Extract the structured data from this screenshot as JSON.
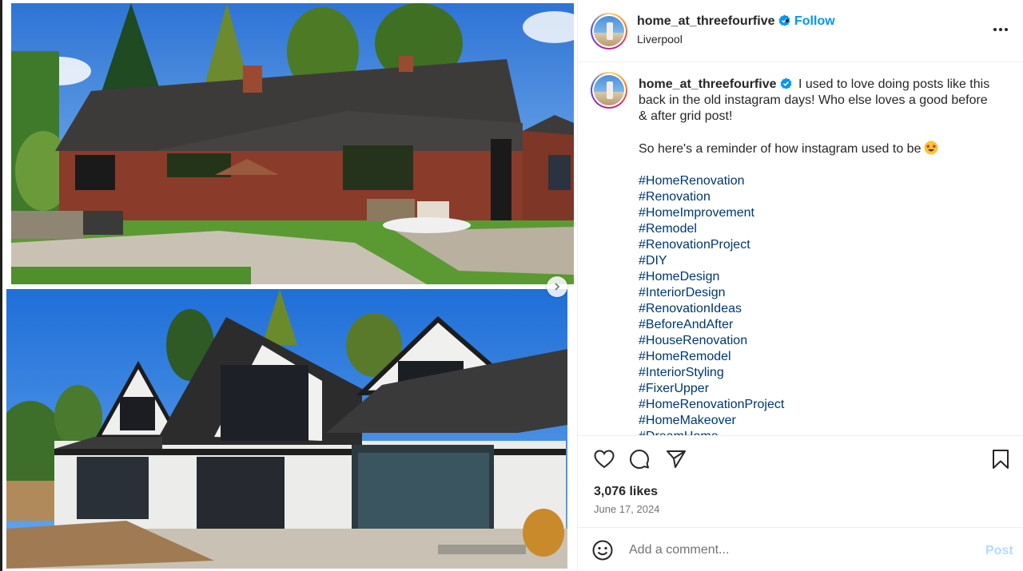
{
  "post": {
    "username": "home_at_threefourfive",
    "verified": true,
    "separator": "•",
    "follow_label": "Follow",
    "location": "Liverpool",
    "caption_lines": [
      "I used to love doing posts like this back in the old instagram days! Who else loves a good before & after grid post!",
      "So here's a reminder of how instagram used to be"
    ],
    "caption_emoji": "star-struck-emoji",
    "hashtags": [
      "#HomeRenovation",
      "#Renovation",
      "#HomeImprovement",
      "#Remodel",
      "#RenovationProject",
      "#DIY",
      "#HomeDesign",
      "#InteriorDesign",
      "#RenovationIdeas",
      "#BeforeAndAfter",
      "#HouseRenovation",
      "#HomeRemodel",
      "#InteriorStyling",
      "#FixerUpper",
      "#HomeRenovationProject",
      "#HomeMakeover",
      "#DreamHome"
    ],
    "likes": "3,076 likes",
    "date": "June 17, 2024"
  },
  "comment": {
    "placeholder": "Add a comment...",
    "post_label": "Post"
  },
  "icons": {
    "like": "heart-icon",
    "comment": "comment-icon",
    "share": "send-icon",
    "save": "bookmark-icon",
    "more": "more-options-icon",
    "emoji": "emoji-icon",
    "next": "chevron-right-icon"
  },
  "colors": {
    "link": "#0095f6",
    "hashtag": "#00376b",
    "muted": "#737373",
    "post_disabled": "#b3dbff"
  }
}
